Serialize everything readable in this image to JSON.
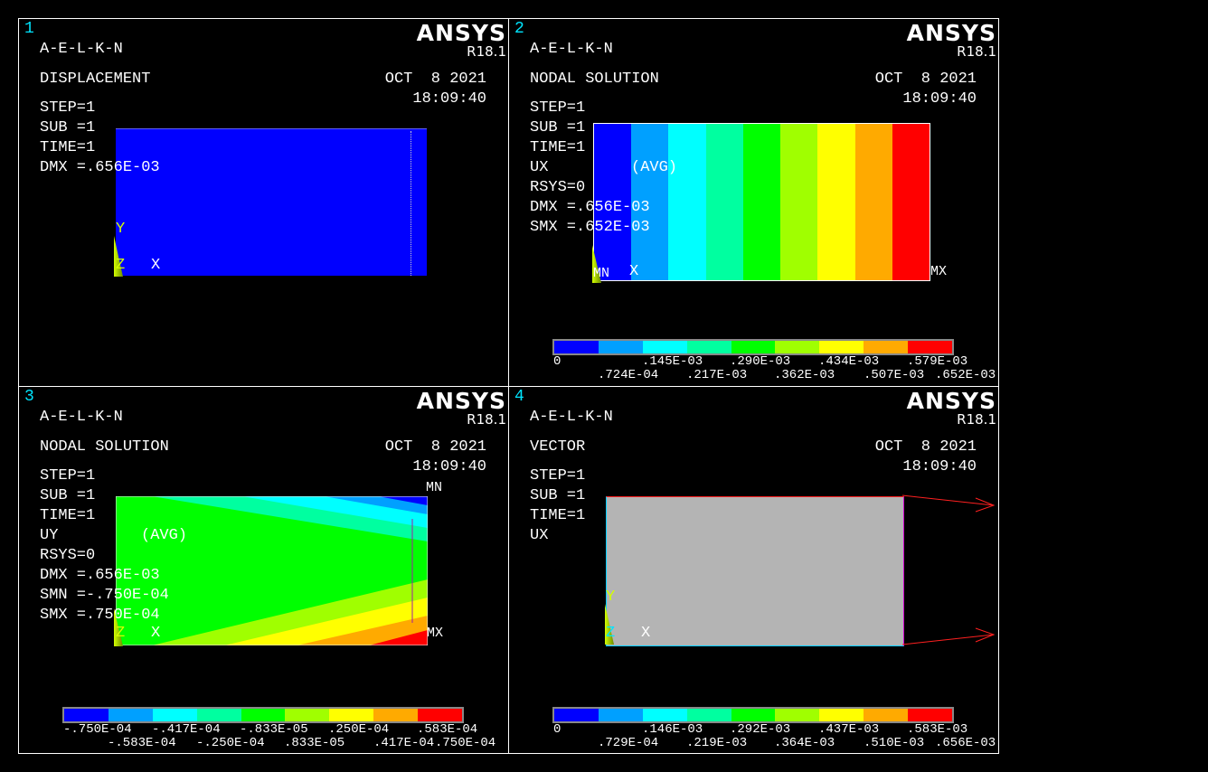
{
  "common": {
    "title": "A-E-L-K-N",
    "brand": "ANSYS",
    "revision": "R18.1",
    "date": "OCT  8 2021",
    "time": "18:09:40",
    "step": "STEP=1",
    "sub": "SUB =1",
    "timeval": "TIME=1",
    "axis_y": "Y",
    "axis_z": "Z",
    "axis_x": "X"
  },
  "panels": [
    {
      "number": "1",
      "kind": "DISPLACEMENT",
      "lines": [
        "DMX =.656E-03"
      ]
    },
    {
      "number": "2",
      "kind": "NODAL SOLUTION",
      "quantity": "UX",
      "avg": "(AVG)",
      "rsys": "RSYS=0",
      "dmx": "DMX =.656E-03",
      "smx": "SMX =.652E-03",
      "mn": "MN",
      "mx": "MX",
      "legend_top": [
        "0",
        ".145E-03",
        ".290E-03",
        ".434E-03",
        ".579E-03"
      ],
      "legend_bottom": [
        ".724E-04",
        ".217E-03",
        ".362E-03",
        ".507E-03",
        ".652E-03"
      ]
    },
    {
      "number": "3",
      "kind": "NODAL SOLUTION",
      "quantity": "UY",
      "avg": "(AVG)",
      "rsys": "RSYS=0",
      "dmx": "DMX =.656E-03",
      "smn": "SMN =-.750E-04",
      "smx": "SMX =.750E-04",
      "mn": "MN",
      "mx": "MX",
      "legend_top": [
        "-.750E-04",
        "-.417E-04",
        "-.833E-05",
        ".250E-04",
        ".583E-04"
      ],
      "legend_bottom": [
        "-.583E-04",
        "-.250E-04",
        ".833E-05",
        ".417E-04",
        ".750E-04"
      ]
    },
    {
      "number": "4",
      "kind": "VECTOR",
      "quantity": "UX",
      "legend_top": [
        "0",
        ".146E-03",
        ".292E-03",
        ".437E-03",
        ".583E-03"
      ],
      "legend_bottom": [
        ".729E-04",
        ".219E-03",
        ".364E-03",
        ".510E-03",
        ".656E-03"
      ]
    }
  ],
  "colors": {
    "contour_scale": [
      "#0000ff",
      "#00a0ff",
      "#00ffff",
      "#00ffa0",
      "#00ff00",
      "#a0ff00",
      "#ffff00",
      "#ffaa00",
      "#ff0000"
    ],
    "plate_gray": "#b4b4b4",
    "vector_arrow": "#ff2020",
    "label_cyan": "#00e5ff",
    "axis_yellow": "#d4ff00"
  }
}
